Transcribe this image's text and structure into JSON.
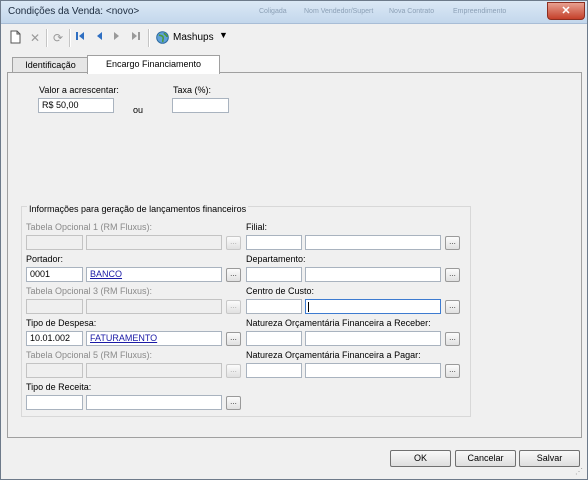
{
  "window": {
    "title": "Condições da Venda: <novo>",
    "ghost_items": [
      "Coligada",
      "Nom Vendedor/Supert",
      "Nova Contrato",
      "Empreendimento"
    ]
  },
  "toolbar": {
    "mashups_label": "Mashups"
  },
  "tabs": [
    {
      "label": "Identificação"
    },
    {
      "label": "Encargo Financiamento"
    }
  ],
  "encargo": {
    "valor_label": "Valor a acrescentar:",
    "valor_value": "R$ 50,00",
    "ou_label": "ou",
    "taxa_label": "Taxa (%):",
    "taxa_value": ""
  },
  "group": {
    "title": "Informações para geração de lançamentos financeiros",
    "left": [
      {
        "label": "Tabela Opcional 1 (RM Fluxus):",
        "code": "",
        "desc": "",
        "enabled": false
      },
      {
        "label": "Portador:",
        "code": "0001",
        "desc": "BANCO",
        "enabled": true
      },
      {
        "label": "Tabela Opcional 3 (RM Fluxus):",
        "code": "",
        "desc": "",
        "enabled": false
      },
      {
        "label": "Tipo de Despesa:",
        "code": "10.01.002",
        "desc": "FATURAMENTO",
        "enabled": true
      },
      {
        "label": "Tabela Opcional 5 (RM Fluxus):",
        "code": "",
        "desc": "",
        "enabled": false
      },
      {
        "label": "Tipo de Receita:",
        "code": "",
        "desc": "",
        "enabled": true
      }
    ],
    "right": [
      {
        "label": "Filial:",
        "code": "",
        "desc": ""
      },
      {
        "label": "Departamento:",
        "code": "",
        "desc": ""
      },
      {
        "label": "Centro de Custo:",
        "code": "",
        "desc": ""
      },
      {
        "label": "Natureza Orçamentária Financeira a Receber:",
        "code": "",
        "desc": ""
      },
      {
        "label": "Natureza Orçamentária Financeira a Pagar:",
        "code": "",
        "desc": ""
      }
    ],
    "lookup_glyph": "..."
  },
  "buttons": {
    "ok": "OK",
    "cancel": "Cancelar",
    "save": "Salvar"
  },
  "icons": {
    "new": "new-document-icon",
    "delete": "delete-icon",
    "refresh": "refresh-icon",
    "first": "first-record-icon",
    "prev": "previous-record-icon",
    "next": "next-record-icon",
    "last": "last-record-icon",
    "mashups": "globe-icon",
    "dropdown": "chevron-down-icon"
  }
}
